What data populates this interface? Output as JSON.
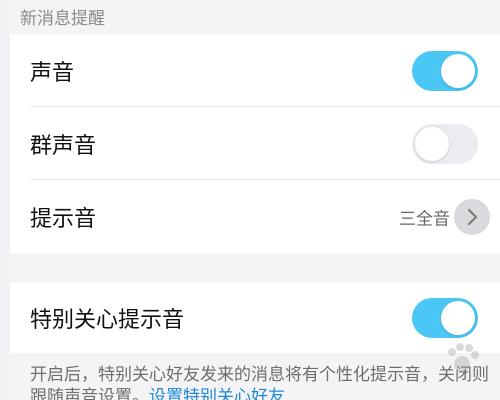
{
  "section_header": "新消息提醒",
  "rows": {
    "sound": {
      "label": "声音",
      "toggle": "on"
    },
    "group_sound": {
      "label": "群声音",
      "toggle": "off"
    },
    "alert_tone": {
      "label": "提示音",
      "value": "三全音"
    },
    "special_care": {
      "label": "特别关心提示音",
      "toggle": "on"
    }
  },
  "footer": {
    "text": "开启后，特别关心好友发来的消息将有个性化提示音，关闭则跟随声音设置。",
    "link": "设置特别关心好友"
  },
  "colors": {
    "toggle_on": "#4bc7f6",
    "toggle_off": "#ebebf1",
    "link": "#1e88d6"
  },
  "icons": [
    "chevron-right-icon",
    "paw-watermark-icon"
  ]
}
